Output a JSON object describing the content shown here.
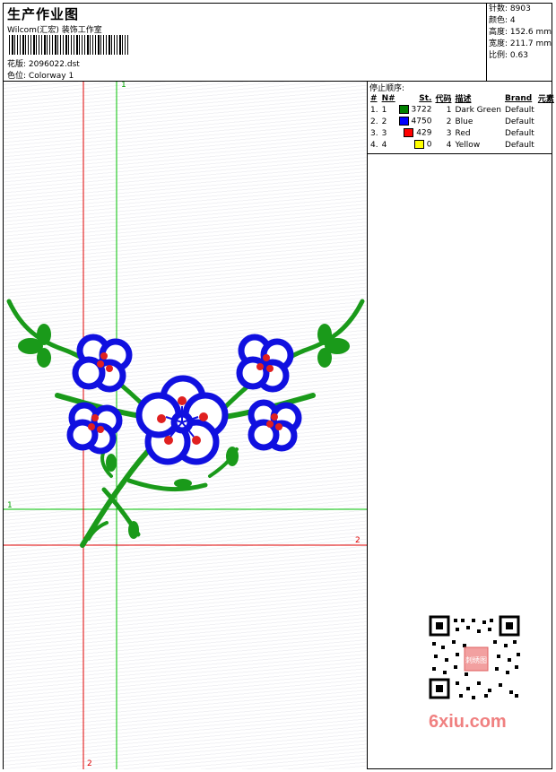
{
  "header": {
    "title": "生产作业图",
    "company": "Wilcom(汇宏) 装饰工作室",
    "pattern_label": "花版:",
    "pattern_value": "2096022.dst",
    "colorway_label": "色位:",
    "colorway_value": "Colorway 1"
  },
  "stats": {
    "stitches": "针数: 8903",
    "colors": "颜色: 4",
    "height": "高度: 152.6 mm",
    "width": "宽度: 211.7 mm",
    "scale": "比例: 0.63"
  },
  "stop_sequence": {
    "heading": "停止顺序:",
    "columns": [
      "#",
      "N#",
      "St.",
      "代码",
      "描述",
      "Brand",
      "元素"
    ],
    "rows": [
      {
        "idx": "1.",
        "n": "1",
        "color": "#008000",
        "stitches": "3722",
        "code": "1",
        "desc": "Dark Green",
        "brand": "Default"
      },
      {
        "idx": "2.",
        "n": "2",
        "color": "#0000ff",
        "stitches": "4750",
        "code": "2",
        "desc": "Blue",
        "brand": "Default"
      },
      {
        "idx": "3.",
        "n": "3",
        "color": "#ff0000",
        "stitches": "429",
        "code": "3",
        "desc": "Red",
        "brand": "Default"
      },
      {
        "idx": "4.",
        "n": "4",
        "color": "#ffff00",
        "stitches": "0",
        "code": "4",
        "desc": "Yellow",
        "brand": "Default"
      }
    ]
  },
  "guides": {
    "green_vertical_label": "1",
    "green_horizontal_label": "1",
    "red_horizontal_label": "2",
    "red_vertical_label": "2"
  },
  "colors": {
    "green": "#1a9a1a",
    "blue": "#1010e0",
    "red": "#e02020",
    "guide_green": "#00c000",
    "guide_red": "#e00000"
  },
  "watermark": {
    "site": "6xiu.com",
    "stamp": "刺绣图"
  }
}
